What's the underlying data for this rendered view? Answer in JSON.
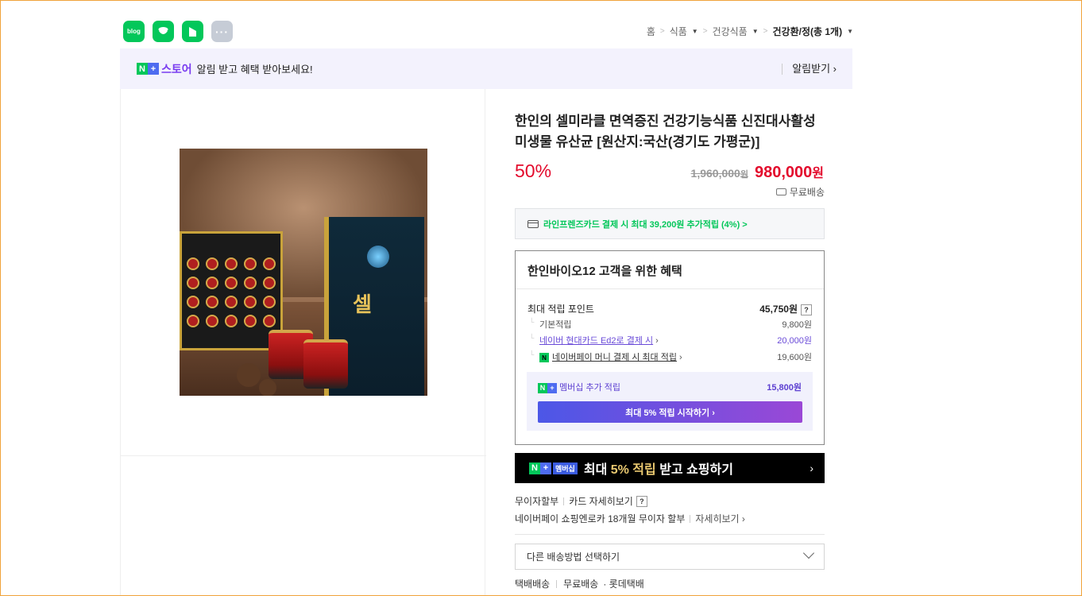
{
  "share": {
    "blog_label": "blog",
    "more_label": "···"
  },
  "breadcrumb": {
    "home": "홈",
    "cat1": "식품",
    "cat2": "건강식품",
    "current": "건강환/정(총 1개)"
  },
  "notice": {
    "store_label": "스토어",
    "message": "알림 받고 혜택 받아보세요!",
    "action": "알림받기 ›"
  },
  "product": {
    "title": "한인의 셀미라클 면역증진 건강기능식품 신진대사활성 미생물 유산균 [원산지:국산(경기도 가평군)]",
    "discount": "50%",
    "original_price": "1,960,000",
    "original_unit": "원",
    "sale_price": "980,000",
    "sale_unit": "원",
    "shipping": "무료배송",
    "card_promo": "라인프렌즈카드 결제 시 최대 39,200원 추가적립 (4%) >"
  },
  "benefits": {
    "header": "한인바이오12 고객을 위한 혜택",
    "max_points_label": "최대 적립 포인트",
    "max_points_value": "45,750원",
    "basic_label": "기본적립",
    "basic_value": "9,800원",
    "hyundai_label": "네이버 현대카드 Ed2로 결제 시",
    "hyundai_value": "20,000원",
    "npay_label": "네이버페이 머니 결제 시 최대 적립",
    "npay_value": "19,600원",
    "membership_label": "멤버십 추가 적립",
    "membership_value": "15,800원",
    "membership_button": "최대 5% 적립 시작하기 ›"
  },
  "banner": {
    "badge": "멤버십",
    "text_pre": "최대 ",
    "text_hl": "5% 적립",
    "text_post": " 받고 쇼핑하기",
    "arrow": "›"
  },
  "payment": {
    "installment": "무이자할부",
    "card_detail": "카드 자세히보기",
    "npay_line": "네이버페이 쇼핑엔로카 18개월 무이자 할부",
    "detail": "자세히보기 ›"
  },
  "delivery": {
    "select_placeholder": "다른 배송방법 선택하기",
    "method": "택배배송",
    "fee": "무료배송",
    "courier": "· 롯데택배"
  },
  "colors": {
    "naver_green": "#03c75a",
    "price_red": "#e30a2c",
    "store_purple": "#7a3df0"
  }
}
